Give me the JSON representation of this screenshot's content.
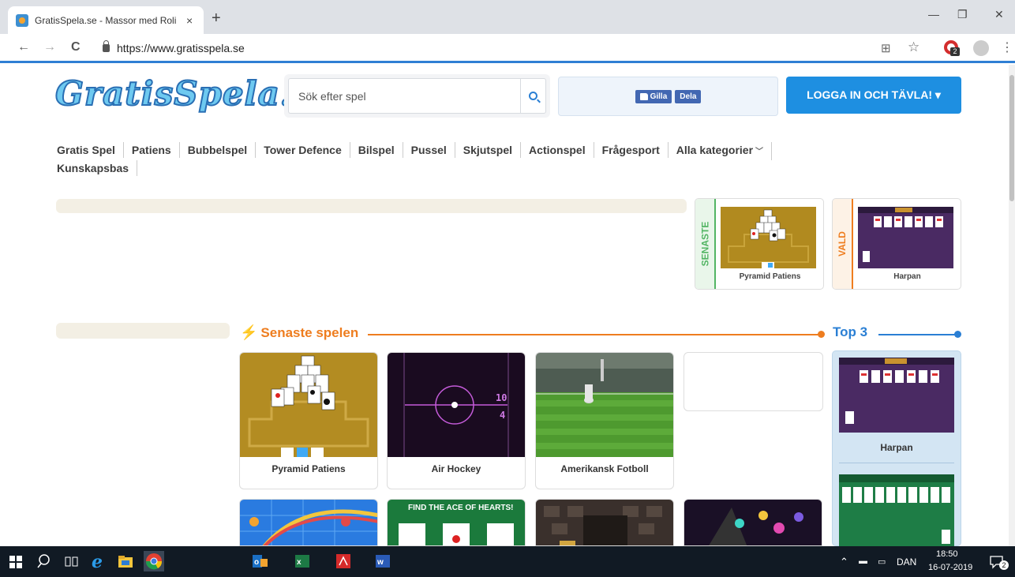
{
  "browser": {
    "tab_title": "GratisSpela.se - Massor med Roli",
    "tab_close": "×",
    "new_tab": "+",
    "back": "←",
    "forward": "→",
    "reload": "C",
    "url": "https://www.gratisspela.se",
    "minimize": "—",
    "maximize": "❐",
    "close": "✕",
    "translate_icon": "⊞",
    "star_icon": "☆",
    "menu_icon": "⋮",
    "ext_badge": "2"
  },
  "site": {
    "logo": "GratisSpela!",
    "search_placeholder": "Sök efter spel",
    "fb_like": "Gilla",
    "fb_share": "Dela",
    "login": "LOGGA IN OCH TÄVLA! ▾"
  },
  "nav": {
    "items": [
      "Gratis Spel",
      "Patiens",
      "Bubbelspel",
      "Tower Defence",
      "Bilspel",
      "Pussel",
      "Skjutspel",
      "Actionspel",
      "Frågesport",
      "Alla kategorier",
      "Kunskapsbas"
    ]
  },
  "featured": {
    "latest_tag": "SENASTE",
    "latest_game": "Pyramid Patiens",
    "chosen_tag": "VALD",
    "chosen_game": "Harpan"
  },
  "section": {
    "latest_title": "Senaste spelen",
    "top3_title": "Top 3"
  },
  "games": [
    {
      "title": "Pyramid Patiens"
    },
    {
      "title": "Air Hockey",
      "score_top": "10",
      "score_bottom": "4"
    },
    {
      "title": "Amerikansk Fotboll"
    }
  ],
  "row2": {
    "banner": "FIND THE ACE OF HEARTS!"
  },
  "top3": {
    "first": "Harpan"
  },
  "taskbar": {
    "lang": "DAN",
    "time": "18:50",
    "date": "16-07-2019",
    "notif_count": "2"
  },
  "colors": {
    "accent_blue": "#1e8fe1",
    "accent_orange": "#ee7d1f",
    "latest_green": "#53b564",
    "chosen_orange": "#ee7d1f"
  }
}
